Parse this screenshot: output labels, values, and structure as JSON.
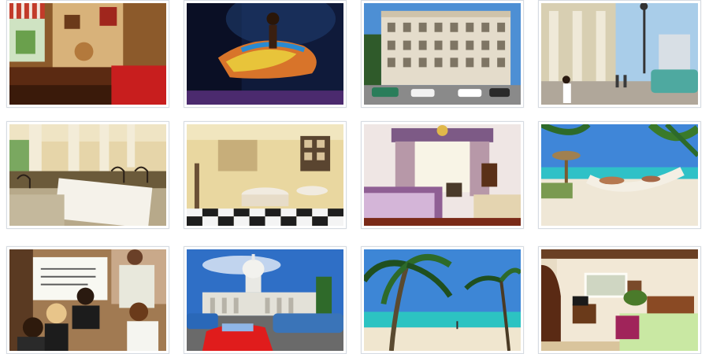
{
  "gallery": {
    "photos": [
      {
        "name": "bar-interior-photo"
      },
      {
        "name": "dancer-photo"
      },
      {
        "name": "hotel-facade-photo"
      },
      {
        "name": "street-scene-photo"
      },
      {
        "name": "restaurant-terrace-photo"
      },
      {
        "name": "dining-room-photo"
      },
      {
        "name": "hotel-bedroom-photo"
      },
      {
        "name": "beach-hammock-photo"
      },
      {
        "name": "people-reading-photo"
      },
      {
        "name": "capitol-classic-cars-photo"
      },
      {
        "name": "palm-beach-photo"
      },
      {
        "name": "guest-room-photo"
      }
    ],
    "colors": {
      "tile_border": "#d6dbe2",
      "sky": "#3f86d8",
      "sea": "#2fc1c7",
      "sand": "#efe7d6"
    }
  }
}
